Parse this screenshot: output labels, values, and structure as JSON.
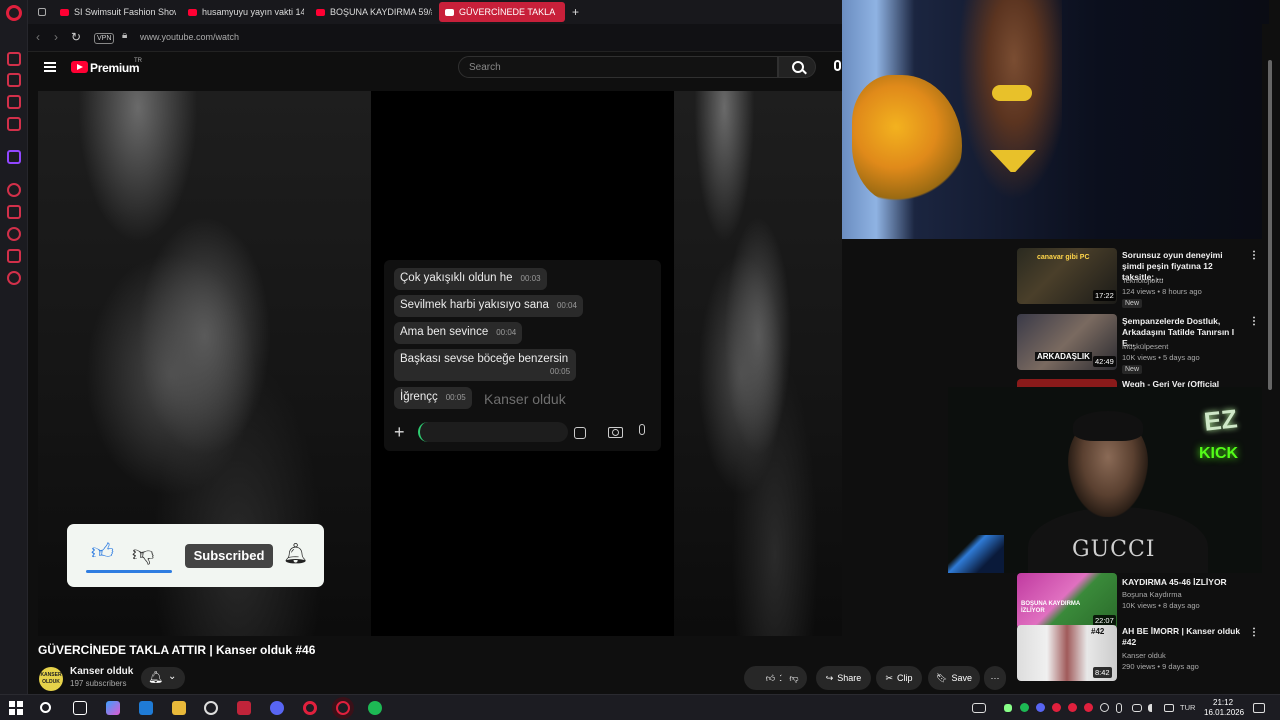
{
  "browser": {
    "tabs": [
      {
        "label": "SI Swimsuit Fashion Show"
      },
      {
        "label": "husamyuyu yayın vakti 14"
      },
      {
        "label": "BOŞUNA KAYDIRMA 59/#"
      },
      {
        "label": "GÜVERCİNEDE TAKLA"
      }
    ],
    "new_tab": "+",
    "vpn_label": "VPN",
    "url": "www.youtube.com/watch"
  },
  "youtube": {
    "brand": "Premium",
    "brand_tm": "TR",
    "search_placeholder": "Search"
  },
  "player": {
    "chat_messages": [
      {
        "text": "Çok yakışıklı oldun he",
        "time": "00:03"
      },
      {
        "text": "Sevilmek harbi yakısıyo sana",
        "time": "00:04"
      },
      {
        "text": "Ama ben sevince",
        "time": "00:04"
      },
      {
        "text": "Başkası sevse böceğe benzersin",
        "time": "00:05"
      },
      {
        "text": "İğrençç",
        "time": "00:05"
      }
    ],
    "watermark": "Kanser olduk",
    "sub_card_button": "Subscribed"
  },
  "video": {
    "title": "GÜVERCİNEDE TAKLA ATTIR | Kanser olduk #46",
    "channel_name": "Kanser olduk",
    "channel_avatar_text": "KANSER OLDUK",
    "subscribers": "197 subscribers",
    "likes": "1",
    "share_label": "Share",
    "clip_label": "Clip",
    "save_label": "Save",
    "more_label": "···"
  },
  "related": [
    {
      "title": "Sorunsuz oyun deneyimi şimdi peşin fiyatına 12 taksitle; ...",
      "channel": "Teknolojioku",
      "meta": "124 views • 8 hours ago",
      "badge": "New",
      "duration": "17:22",
      "thumb_text": "canavar gibi PC"
    },
    {
      "title": "Şempanzelerde Dostluk, Arkadaşını Tatilde Tanırsın I E...",
      "channel": "Müşkülpesent",
      "meta": "10K views • 5 days ago",
      "badge": "New",
      "duration": "42:49",
      "thumb_text": "ARKADAŞLIK"
    },
    {
      "title": "Wegh - Geri Ver (Official Music",
      "channel": "",
      "meta": "",
      "badge": "",
      "duration": "",
      "thumb_text": ""
    },
    {
      "title": "KAYDIRMA 45-46 İZLİYOR",
      "channel": "Boşuna Kaydırma",
      "meta": "10K views • 8 days ago",
      "badge": "",
      "duration": "22:07",
      "thumb_text": "BOŞUNA KAYDIRMA İZLİYOR"
    },
    {
      "title": "AH BE İMORR | Kanser olduk #42",
      "channel": "Kanser olduk",
      "meta": "290 views • 9 days ago",
      "badge": "",
      "duration": "8:42",
      "thumb_text": "#42"
    }
  ],
  "webcam": {
    "sign_top": "EZ",
    "sign_bottom": "KICK",
    "shirt_text": "GUCCI"
  },
  "taskbar": {
    "lang": "TUR",
    "time": "21:12",
    "date": "16.01.2026"
  },
  "colors": {
    "accent_red": "#ff0033",
    "opera_red": "#d2304a",
    "like_blue": "#2f7de1",
    "kick_green": "#53fc18"
  }
}
